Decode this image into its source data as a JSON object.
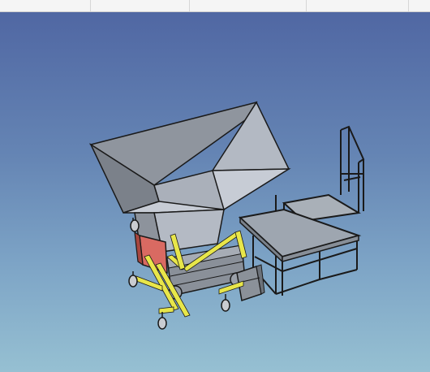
{
  "header": {
    "columns": [
      "",
      "",
      "",
      "",
      ""
    ]
  },
  "viewport": {
    "background_top": "#5067a3",
    "background_bottom": "#96c0d2"
  },
  "model": {
    "frame_color": "#e8e64a",
    "motor_color": "#d96a62",
    "sheet_color": "#b9bfcc",
    "edge_color": "#1a1a1a"
  }
}
